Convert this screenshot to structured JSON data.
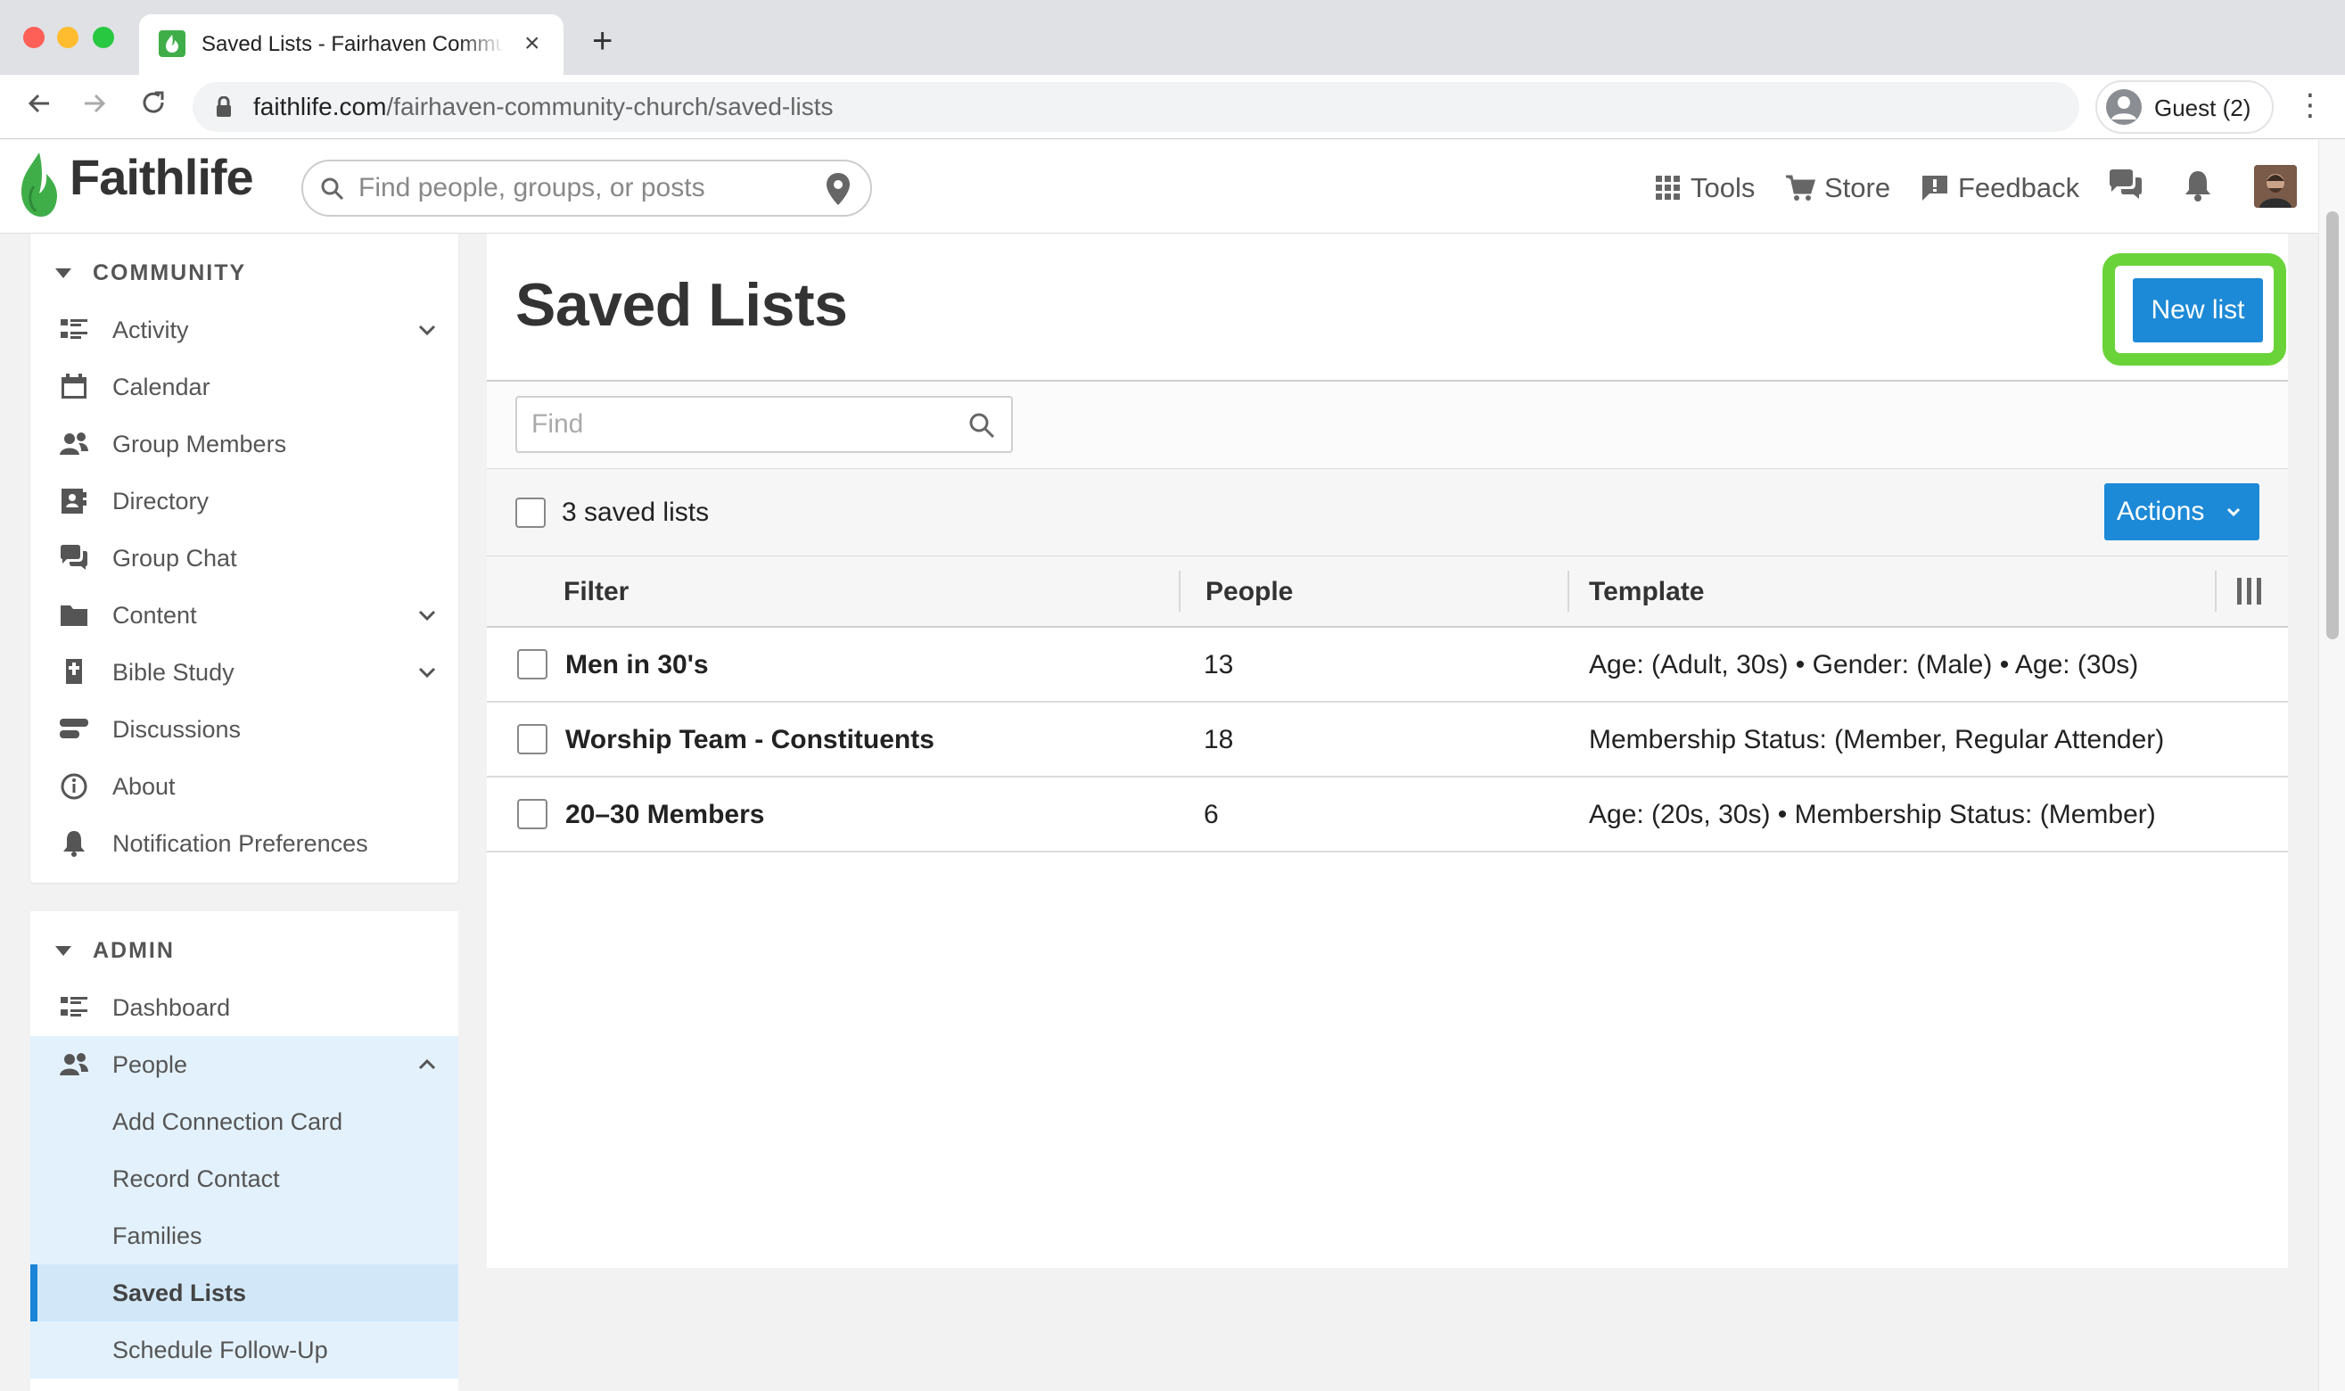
{
  "browser": {
    "tab_title": "Saved Lists - Fairhaven Community Church",
    "url_host": "faithlife.com",
    "url_path": "/fairhaven-community-church/saved-lists",
    "profile_label": "Guest (2)"
  },
  "header": {
    "logo": "Faithlife",
    "search_placeholder": "Find people, groups, or posts",
    "tools_label": "Tools",
    "store_label": "Store",
    "feedback_label": "Feedback"
  },
  "sidebar": {
    "community_heading": "COMMUNITY",
    "community_items": [
      {
        "label": "Activity",
        "icon": "activity-icon",
        "has_chevron": true
      },
      {
        "label": "Calendar",
        "icon": "calendar-icon",
        "has_chevron": false
      },
      {
        "label": "Group Members",
        "icon": "members-icon",
        "has_chevron": false
      },
      {
        "label": "Directory",
        "icon": "directory-icon",
        "has_chevron": false
      },
      {
        "label": "Group Chat",
        "icon": "chat-icon",
        "has_chevron": false
      },
      {
        "label": "Content",
        "icon": "folder-icon",
        "has_chevron": true
      },
      {
        "label": "Bible Study",
        "icon": "bible-icon",
        "has_chevron": true
      },
      {
        "label": "Discussions",
        "icon": "discussions-icon",
        "has_chevron": false
      },
      {
        "label": "About",
        "icon": "info-icon",
        "has_chevron": false
      },
      {
        "label": "Notification Preferences",
        "icon": "bell-icon",
        "has_chevron": false
      }
    ],
    "admin_heading": "ADMIN",
    "admin_items": [
      {
        "label": "Dashboard",
        "icon": "dashboard-icon"
      },
      {
        "label": "People",
        "icon": "people-icon",
        "expanded": true
      }
    ],
    "people_subitems": [
      {
        "label": "Add Connection Card"
      },
      {
        "label": "Record Contact"
      },
      {
        "label": "Families"
      },
      {
        "label": "Saved Lists",
        "active": true
      },
      {
        "label": "Schedule Follow-Up"
      }
    ]
  },
  "main": {
    "title": "Saved Lists",
    "new_list_label": "New list",
    "find_placeholder": "Find",
    "count_label": "3 saved lists",
    "actions_label": "Actions",
    "columns": {
      "filter": "Filter",
      "people": "People",
      "template": "Template"
    },
    "rows": [
      {
        "name": "Men in 30's",
        "people": "13",
        "template": "Age: (Adult, 30s) • Gender: (Male) • Age: (30s)"
      },
      {
        "name": "Worship Team - Constituents",
        "people": "18",
        "template": "Membership Status: (Member, Regular Attender)"
      },
      {
        "name": "20–30 Members",
        "people": "6",
        "template": "Age: (20s, 30s) • Membership Status: (Member)"
      }
    ]
  },
  "colors": {
    "primary_button": "#1d8ad7",
    "highlight": "#6ad33a",
    "brand_green": "#3fae49",
    "nav_active": "#d2e8f9"
  }
}
